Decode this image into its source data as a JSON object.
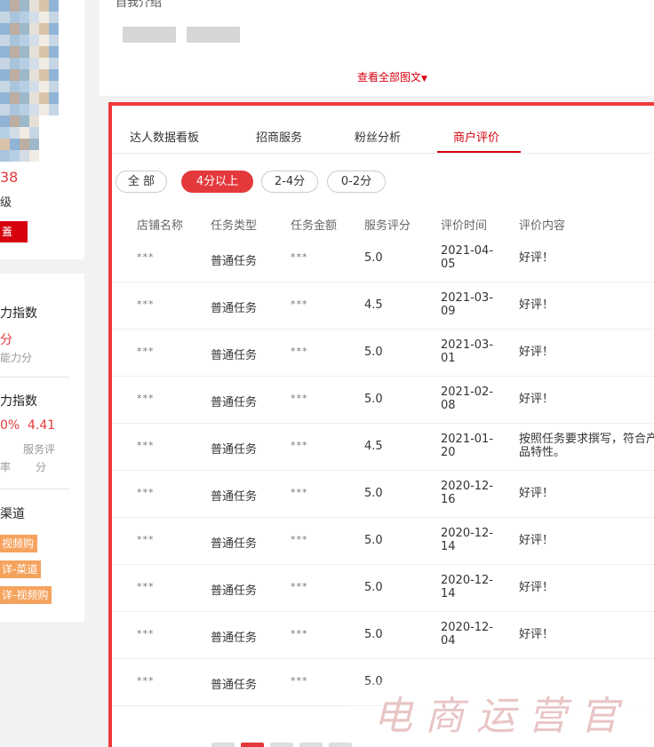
{
  "sidebar_top": {
    "number": "38",
    "sub": "级",
    "red_button": "蓋"
  },
  "sidebar_bottom": {
    "index1_title": "力指数",
    "index1_score": "分",
    "index1_sub": "能力分",
    "index2_title": "力指数",
    "index2_pct": "0%",
    "index2_value": "4.41",
    "index2_label_a": "率",
    "index2_label_b": "服务评",
    "index2_label_c": "分",
    "channel_title": "渠道",
    "tags": [
      "视频购",
      "详-菜道",
      "详-视频购"
    ]
  },
  "intro": {
    "cut_title": "自我介绍",
    "view_all": "查看全部图文"
  },
  "tabs": [
    {
      "label": "达人数据看板"
    },
    {
      "label": "招商服务"
    },
    {
      "label": "粉丝分析"
    },
    {
      "label": "商户评价"
    }
  ],
  "filters": [
    {
      "label": "全 部"
    },
    {
      "label": "4分以上"
    },
    {
      "label": "2-4分"
    },
    {
      "label": "0-2分"
    }
  ],
  "table": {
    "headers": [
      "店铺名称",
      "任务类型",
      "任务金额",
      "服务评分",
      "评价时间",
      "评价内容"
    ],
    "rows": [
      {
        "shop": "***",
        "type": "普通任务",
        "amount": "***",
        "score": "5.0",
        "date": "2021-04-05",
        "content": "好评！"
      },
      {
        "shop": "***",
        "type": "普通任务",
        "amount": "***",
        "score": "4.5",
        "date": "2021-03-09",
        "content": "好评！"
      },
      {
        "shop": "***",
        "type": "普通任务",
        "amount": "***",
        "score": "5.0",
        "date": "2021-03-01",
        "content": "好评！"
      },
      {
        "shop": "***",
        "type": "普通任务",
        "amount": "***",
        "score": "5.0",
        "date": "2021-02-08",
        "content": "好评！"
      },
      {
        "shop": "***",
        "type": "普通任务",
        "amount": "***",
        "score": "4.5",
        "date": "2021-01-20",
        "content": "按照任务要求撰写，符合产品特性。"
      },
      {
        "shop": "***",
        "type": "普通任务",
        "amount": "***",
        "score": "5.0",
        "date": "2020-12-16",
        "content": "好评！"
      },
      {
        "shop": "***",
        "type": "普通任务",
        "amount": "***",
        "score": "5.0",
        "date": "2020-12-14",
        "content": "好评！"
      },
      {
        "shop": "***",
        "type": "普通任务",
        "amount": "***",
        "score": "5.0",
        "date": "2020-12-14",
        "content": "好评！"
      },
      {
        "shop": "***",
        "type": "普通任务",
        "amount": "***",
        "score": "5.0",
        "date": "2020-12-04",
        "content": "好评！"
      },
      {
        "shop": "***",
        "type": "普通任务",
        "amount": "***",
        "score": "5.0",
        "date": "",
        "content": ""
      }
    ]
  },
  "watermark": "电商运营官",
  "colors": {
    "accent": "#d7000f",
    "border": "#ee3a3a",
    "tag": "#f5a25d"
  }
}
